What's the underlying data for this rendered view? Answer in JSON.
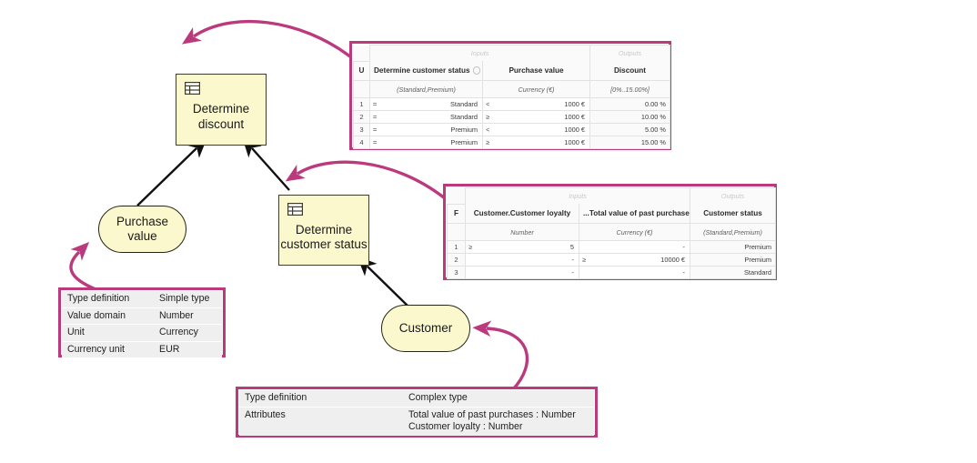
{
  "nodes": {
    "decision_discount": {
      "label": "Determine\ndiscount",
      "icon": "decision-table-icon"
    },
    "decision_status": {
      "label": "Determine\ncustomer status",
      "icon": "decision-table-icon"
    },
    "input_purchase": {
      "label": "Purchase\nvalue"
    },
    "input_customer": {
      "label": "Customer"
    }
  },
  "discount_table": {
    "hit_policy": "U",
    "group_inputs": "Inputs",
    "group_outputs": "Outputs",
    "columns": [
      {
        "name": "Determine customer status",
        "type": "(Standard,Premium)",
        "has_info_icon": true
      },
      {
        "name": "Purchase value",
        "type": "Currency (€)",
        "has_info_icon": false
      },
      {
        "name": "Discount",
        "type": "[0%..15.00%]",
        "has_info_icon": false
      }
    ],
    "rows": [
      {
        "index": "1",
        "in1_op": "=",
        "in1_val": "Standard",
        "in2_op": "<",
        "in2_val": "1000 €",
        "out": "0.00 %"
      },
      {
        "index": "2",
        "in1_op": "=",
        "in1_val": "Standard",
        "in2_op": "≥",
        "in2_val": "1000 €",
        "out": "10.00 %"
      },
      {
        "index": "3",
        "in1_op": "=",
        "in1_val": "Premium",
        "in2_op": "<",
        "in2_val": "1000 €",
        "out": "5.00 %"
      },
      {
        "index": "4",
        "in1_op": "=",
        "in1_val": "Premium",
        "in2_op": "≥",
        "in2_val": "1000 €",
        "out": "15.00 %"
      }
    ]
  },
  "status_table": {
    "hit_policy": "F",
    "group_inputs": "Inputs",
    "group_outputs": "Outputs",
    "columns": [
      {
        "name": "Customer.Customer loyalty",
        "type": "Number"
      },
      {
        "name": "...Total value of past purchases",
        "type": "Currency (€)"
      },
      {
        "name": "Customer status",
        "type": "(Standard,Premium)"
      }
    ],
    "rows": [
      {
        "index": "1",
        "in1_op": "≥",
        "in1_val": "5",
        "in2_op": "",
        "in2_val": "-",
        "out": "Premium"
      },
      {
        "index": "2",
        "in1_op": "",
        "in1_val": "-",
        "in2_op": "≥",
        "in2_val": "10000 €",
        "out": "Premium"
      },
      {
        "index": "3",
        "in1_op": "",
        "in1_val": "-",
        "in2_op": "",
        "in2_val": "-",
        "out": "Standard"
      }
    ]
  },
  "purchase_properties": {
    "rows": [
      {
        "label": "Type definition",
        "value": "Simple type"
      },
      {
        "label": "Value domain",
        "value": "Number"
      },
      {
        "label": "Unit",
        "value": "Currency"
      },
      {
        "label": "Currency unit",
        "value": "EUR"
      }
    ]
  },
  "customer_properties": {
    "rows": [
      {
        "label": "Type definition",
        "value": "Complex type"
      },
      {
        "label": "Attributes",
        "value": "Total value of past purchases : Number\nCustomer loyalty : Number"
      }
    ]
  },
  "colors": {
    "accent_magenta": "#bb3a7d",
    "node_fill": "#fbf8cd",
    "node_stroke": "#3d3d29",
    "connector": "#111111"
  }
}
